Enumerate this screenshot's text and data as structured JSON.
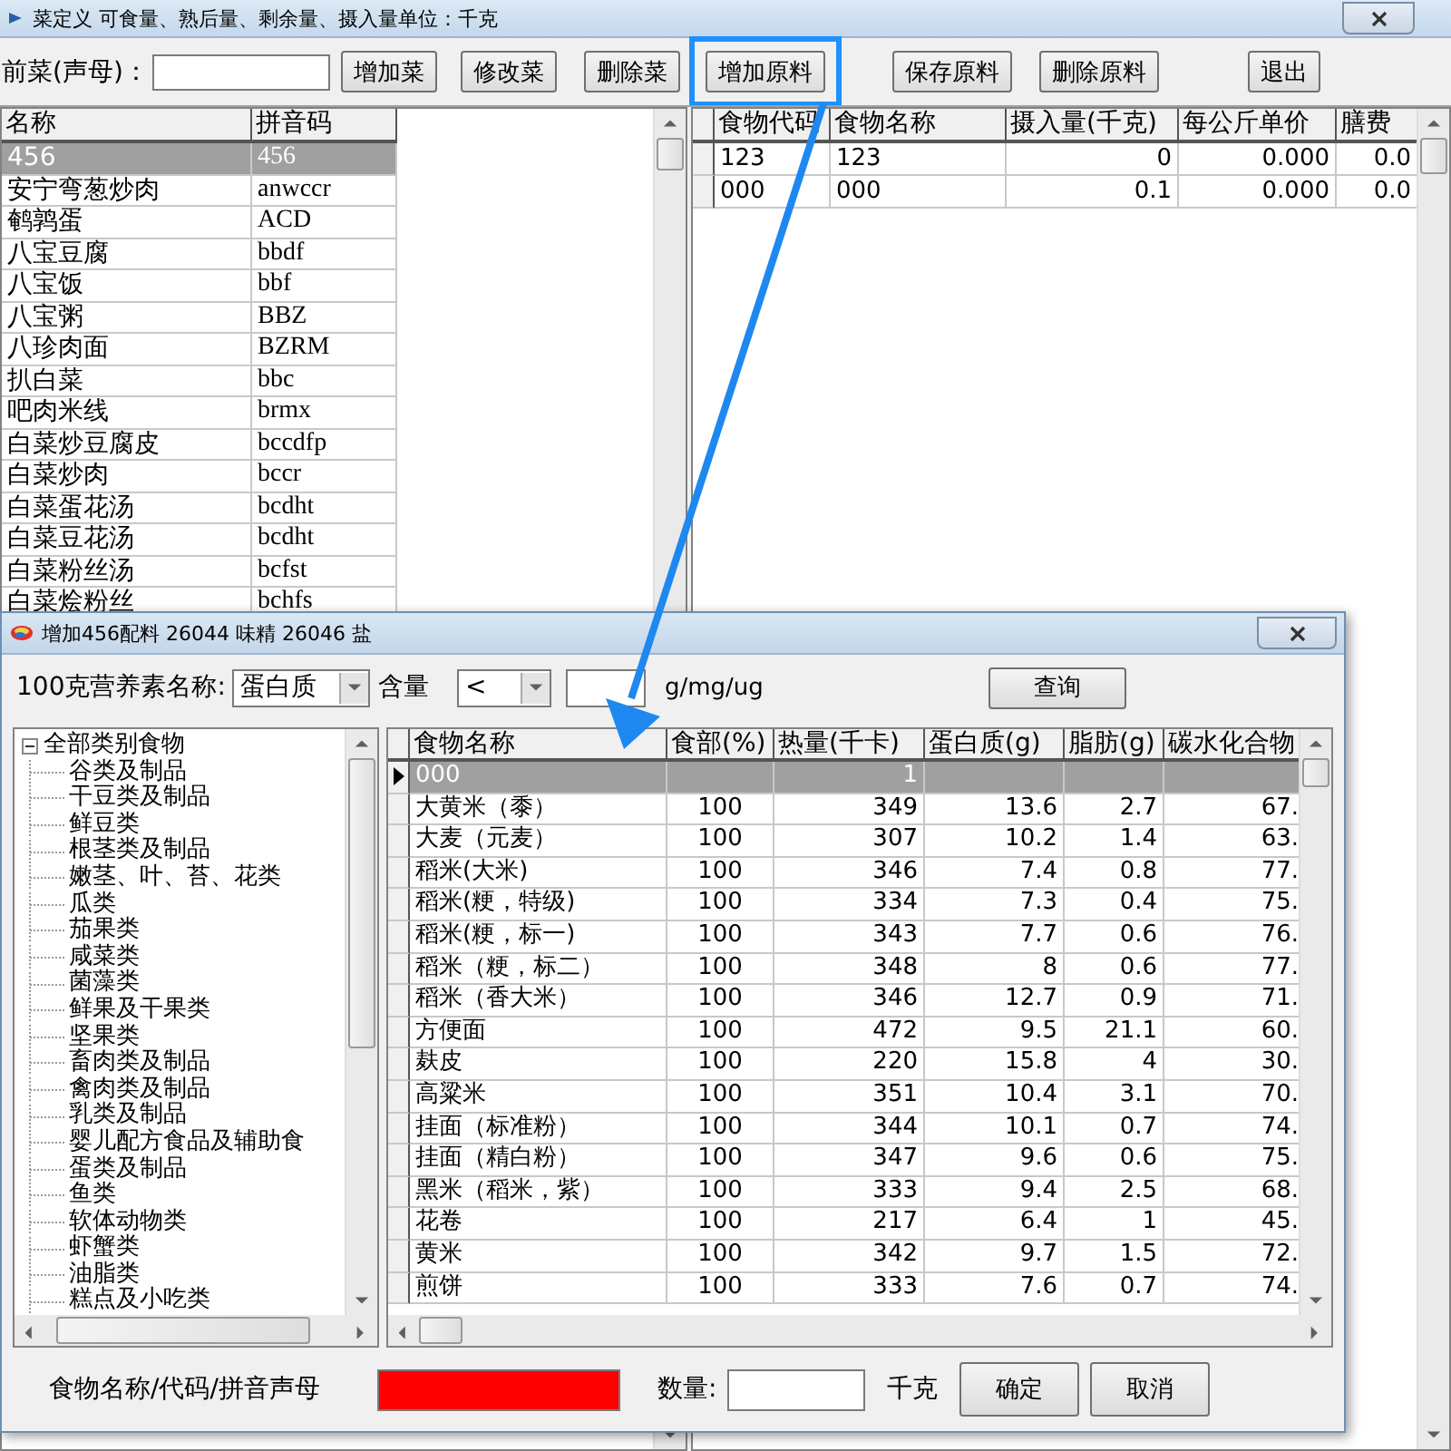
{
  "window": {
    "title": "菜定义  可食量、熟后量、剩余量、摄入量单位：千克"
  },
  "toolbar": {
    "label": "前菜(声母)：",
    "buttons": [
      {
        "label": "增加菜",
        "highlighted": false
      },
      {
        "label": "修改菜",
        "highlighted": false
      },
      {
        "label": "删除菜",
        "highlighted": false
      },
      {
        "label": "增加原料",
        "highlighted": true
      },
      {
        "label": "保存原料",
        "highlighted": false
      },
      {
        "label": "删除原料",
        "highlighted": false
      },
      {
        "label": "退出",
        "highlighted": false
      }
    ]
  },
  "dish_table": {
    "columns": [
      "名称",
      "拼音码"
    ],
    "rows": [
      {
        "name": "456",
        "pinyin": "456",
        "selected": true
      },
      {
        "name": "安宁弯葱炒肉",
        "pinyin": "anwccr",
        "selected": false
      },
      {
        "name": "鹌鹑蛋",
        "pinyin": "ACD",
        "selected": false
      },
      {
        "name": "八宝豆腐",
        "pinyin": "bbdf",
        "selected": false
      },
      {
        "name": "八宝饭",
        "pinyin": "bbf",
        "selected": false
      },
      {
        "name": "八宝粥",
        "pinyin": "BBZ",
        "selected": false
      },
      {
        "name": "八珍肉面",
        "pinyin": "BZRM",
        "selected": false
      },
      {
        "name": "扒白菜",
        "pinyin": "bbc",
        "selected": false
      },
      {
        "name": "吧肉米线",
        "pinyin": "brmx",
        "selected": false
      },
      {
        "name": "白菜炒豆腐皮",
        "pinyin": "bccdfp",
        "selected": false
      },
      {
        "name": "白菜炒肉",
        "pinyin": "bccr",
        "selected": false
      },
      {
        "name": "白菜蛋花汤",
        "pinyin": "bcdht",
        "selected": false
      },
      {
        "name": "白菜豆花汤",
        "pinyin": "bcdht",
        "selected": false
      },
      {
        "name": "白菜粉丝汤",
        "pinyin": "bcfst",
        "selected": false
      },
      {
        "name": "白菜烩粉丝",
        "pinyin": "bchfs",
        "selected": false
      }
    ]
  },
  "ingredient_table": {
    "columns": [
      "食物代码",
      "食物名称",
      "摄入量(千克)",
      "每公斤单价",
      "膳费"
    ],
    "rows": [
      {
        "code": "123",
        "name": "123",
        "intake": "0",
        "unit_price": "0.000",
        "cost": "0.0"
      },
      {
        "code": "000",
        "name": "000",
        "intake": "0.1",
        "unit_price": "0.000",
        "cost": "0.0"
      }
    ]
  },
  "dialog": {
    "title": "增加456配料  26044 味精  26046 盐",
    "filter": {
      "label": "100克营养素名称:",
      "nutrient": "蛋白质",
      "amount_label": "含量",
      "operator": "<",
      "unit": "g/mg/ug",
      "button": "查询"
    },
    "tree": {
      "label": "全部类别食物",
      "expanded": true,
      "children": [
        {
          "label": "谷类及制品"
        },
        {
          "label": "干豆类及制品"
        },
        {
          "label": "鲜豆类"
        },
        {
          "label": "根茎类及制品"
        },
        {
          "label": "嫩茎、叶、苔、花类"
        },
        {
          "label": "瓜类"
        },
        {
          "label": "茄果类"
        },
        {
          "label": "咸菜类"
        },
        {
          "label": "菌藻类"
        },
        {
          "label": "鲜果及干果类"
        },
        {
          "label": "坚果类"
        },
        {
          "label": "畜肉类及制品"
        },
        {
          "label": "禽肉类及制品"
        },
        {
          "label": "乳类及制品"
        },
        {
          "label": "婴儿配方食品及辅助食"
        },
        {
          "label": "蛋类及制品"
        },
        {
          "label": "鱼类"
        },
        {
          "label": "软体动物类"
        },
        {
          "label": "虾蟹类"
        },
        {
          "label": "油脂类"
        },
        {
          "label": "糕点及小吃类"
        }
      ]
    },
    "food_table": {
      "columns": [
        "食物名称",
        "食部(%)",
        "热量(千卡)",
        "蛋白质(g)",
        "脂肪(g)",
        "碳水化合物"
      ],
      "rows": [
        {
          "name": "000",
          "energy": "1",
          "selected": true
        },
        {
          "name": "大黄米（黍）",
          "edible": "100",
          "energy": "349",
          "protein": "13.6",
          "fat": "2.7",
          "carbs": "67.",
          "selected": false
        },
        {
          "name": "大麦（元麦）",
          "edible": "100",
          "energy": "307",
          "protein": "10.2",
          "fat": "1.4",
          "carbs": "63.",
          "selected": false
        },
        {
          "name": "稻米(大米)",
          "edible": "100",
          "energy": "346",
          "protein": "7.4",
          "fat": "0.8",
          "carbs": "77.",
          "selected": false
        },
        {
          "name": "稻米(粳，特级)",
          "edible": "100",
          "energy": "334",
          "protein": "7.3",
          "fat": "0.4",
          "carbs": "75.",
          "selected": false
        },
        {
          "name": "稻米(粳，标一)",
          "edible": "100",
          "energy": "343",
          "protein": "7.7",
          "fat": "0.6",
          "carbs": "76.",
          "selected": false
        },
        {
          "name": "稻米（粳，标二）",
          "edible": "100",
          "energy": "348",
          "protein": "8",
          "fat": "0.6",
          "carbs": "77.",
          "selected": false
        },
        {
          "name": "稻米（香大米）",
          "edible": "100",
          "energy": "346",
          "protein": "12.7",
          "fat": "0.9",
          "carbs": "71.",
          "selected": false
        },
        {
          "name": "方便面",
          "edible": "100",
          "energy": "472",
          "protein": "9.5",
          "fat": "21.1",
          "carbs": "60.",
          "selected": false
        },
        {
          "name": "麸皮",
          "edible": "100",
          "energy": "220",
          "protein": "15.8",
          "fat": "4",
          "carbs": "30.",
          "selected": false
        },
        {
          "name": "高粱米",
          "edible": "100",
          "energy": "351",
          "protein": "10.4",
          "fat": "3.1",
          "carbs": "70.",
          "selected": false
        },
        {
          "name": "挂面（标准粉）",
          "edible": "100",
          "energy": "344",
          "protein": "10.1",
          "fat": "0.7",
          "carbs": "74.",
          "selected": false
        },
        {
          "name": "挂面（精白粉）",
          "edible": "100",
          "energy": "347",
          "protein": "9.6",
          "fat": "0.6",
          "carbs": "75.",
          "selected": false
        },
        {
          "name": "黑米（稻米，紫）",
          "edible": "100",
          "energy": "333",
          "protein": "9.4",
          "fat": "2.5",
          "carbs": "68.",
          "selected": false
        },
        {
          "name": "花卷",
          "edible": "100",
          "energy": "217",
          "protein": "6.4",
          "fat": "1",
          "carbs": "45.",
          "selected": false
        },
        {
          "name": "黄米",
          "edible": "100",
          "energy": "342",
          "protein": "9.7",
          "fat": "1.5",
          "carbs": "72.",
          "selected": false
        },
        {
          "name": "煎饼",
          "edible": "100",
          "energy": "333",
          "protein": "7.6",
          "fat": "0.7",
          "carbs": "74.",
          "selected": false
        }
      ]
    },
    "footer": {
      "label": "食物名称/代码/拼音声母",
      "food_field_highlighted": true,
      "quantity_label": "数量:",
      "unit": "千克",
      "buttons": [
        "确定",
        "取消"
      ]
    }
  }
}
